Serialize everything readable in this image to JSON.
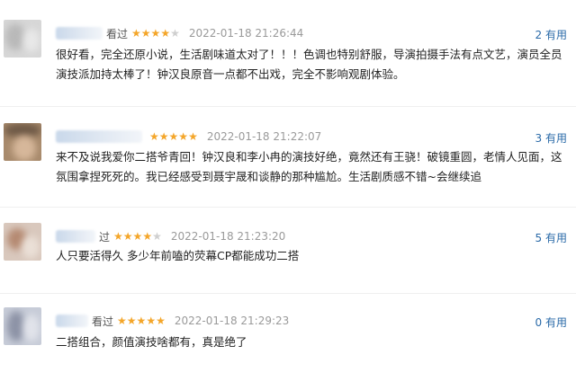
{
  "reviews": [
    {
      "watched": "看过",
      "rating": 4,
      "time": "2022-01-18 21:26:44",
      "useful": "2 有用",
      "content": "很好看，完全还原小说，生活剧味道太对了！！！色调也特别舒服，导演拍摄手法有点文艺，演员全员演技派加持太棒了！钟汉良原音一点都不出戏，完全不影响观剧体验。"
    },
    {
      "watched": "",
      "rating": 5,
      "time": "2022-01-18 21:22:07",
      "useful": "3 有用",
      "content": "来不及说我爱你二搭爷青回！钟汉良和李小冉的演技好绝，竟然还有王骁！破镜重圆，老情人见面，这氛围拿捏死死的。我已经感受到聂宇晟和谈静的那种尴尬。生活剧质感不错~会继续追"
    },
    {
      "watched": "过",
      "rating": 4,
      "time": "2022-01-18 21:23:20",
      "useful": "5 有用",
      "content": "人只要活得久 多少年前嗑的荧幕CP都能成功二搭"
    },
    {
      "watched": "看过",
      "rating": 5,
      "time": "2022-01-18 21:29:23",
      "useful": "0 有用",
      "content": "二搭组合，颜值演技啥都有，真是绝了"
    }
  ],
  "colors": {
    "star_on": "#f4a62a",
    "star_off": "#cfcfcf",
    "useful_link": "#2a6aa8"
  },
  "icons": {
    "star": "star-icon"
  }
}
